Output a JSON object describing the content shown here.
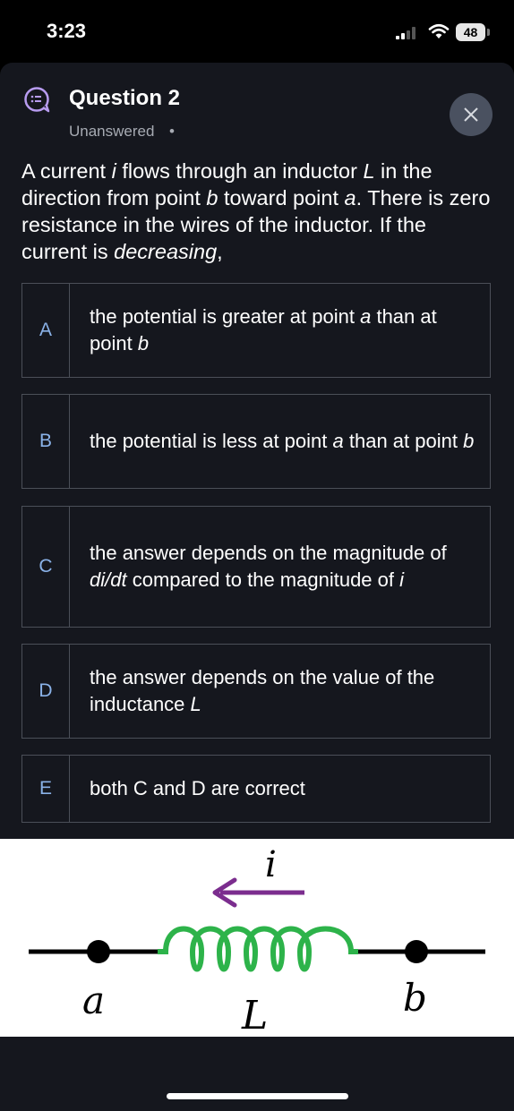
{
  "status_bar": {
    "time": "3:23",
    "battery": "48"
  },
  "header": {
    "title": "Question 2",
    "status": "Unanswered",
    "status_separator": "•"
  },
  "question": {
    "part1": "A current ",
    "i": "i",
    "part2": " flows through an inductor ",
    "L": "L",
    "part3": " in the direction from point ",
    "b": "b",
    "part4": " toward point ",
    "a": "a",
    "part5": ". There is zero resistance in the wires of the inductor. If the current is ",
    "decreasing": "decreasing",
    "part6": ","
  },
  "options": {
    "A": {
      "letter": "A",
      "t1": "the potential is greater at point ",
      "v1": "a",
      "t2": " than at point ",
      "v2": "b"
    },
    "B": {
      "letter": "B",
      "t1": "the potential is less at point ",
      "v1": "a",
      "t2": " than at point ",
      "v2": "b"
    },
    "C": {
      "letter": "C",
      "t1": "the answer depends on the magnitude of ",
      "v1": "di/dt",
      "t2": " compared to the magnitude of ",
      "v2": "i"
    },
    "D": {
      "letter": "D",
      "t1": "the answer depends on the value of the inductance ",
      "v1": "L"
    },
    "E": {
      "letter": "E",
      "t1": "both C and D are correct"
    }
  },
  "diagram": {
    "current_label": "i",
    "point_a": "a",
    "point_b": "b",
    "inductor_label": "L",
    "arrow_color": "#7b2d8e",
    "coil_color": "#2db34a"
  },
  "colors": {
    "card_bg": "#15171e",
    "option_letter": "#8ab2e8",
    "close_button_bg": "#4a5160"
  }
}
